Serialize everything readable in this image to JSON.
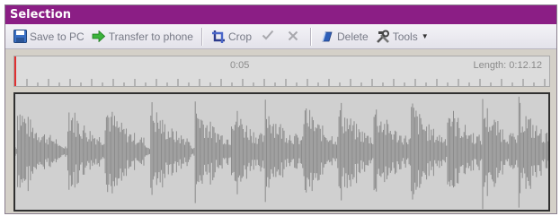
{
  "panel": {
    "title": "Selection"
  },
  "toolbar": {
    "save_label": "Save to PC",
    "transfer_label": "Transfer to phone",
    "crop_label": "Crop",
    "delete_label": "Delete",
    "tools_label": "Tools"
  },
  "icons": {
    "save": "floppy-disk-icon",
    "transfer": "green-arrow-right-icon",
    "crop": "crop-icon",
    "confirm": "checkmark-icon",
    "cancel": "x-icon",
    "delete": "eraser-icon",
    "tools": "tools-icon"
  },
  "timeline": {
    "cursor_time": "0:05",
    "length_text": "Length: 0:12.12"
  },
  "colors": {
    "title_bar": "#8b1e85",
    "waveform": "#8c8c8c",
    "playhead": "#e03030"
  }
}
